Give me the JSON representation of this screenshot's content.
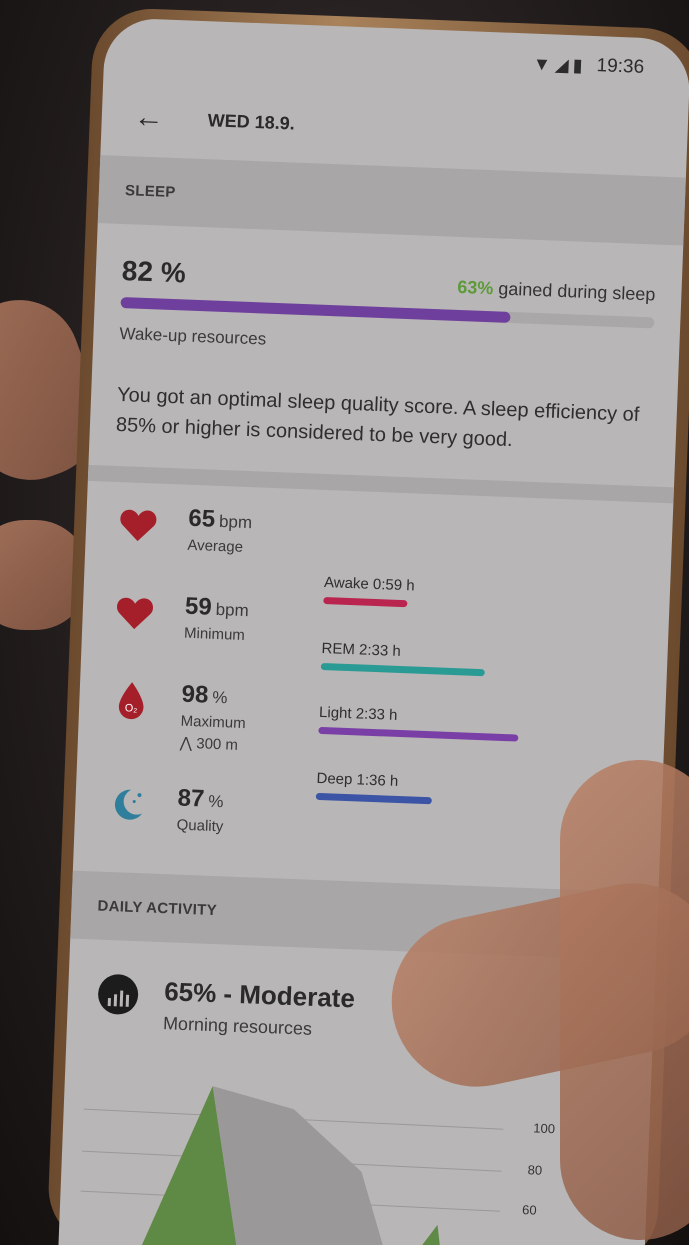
{
  "status": {
    "time": "19:36",
    "icons": "▼◢▮"
  },
  "appbar": {
    "back_icon": "←",
    "title": "WED 18.9."
  },
  "sleep": {
    "header": "SLEEP",
    "score": "82 %",
    "gain_pct": "63%",
    "gain_text": " gained during sleep",
    "progress": 0.73,
    "resources_label": "Wake-up resources",
    "description": "You got an optimal sleep quality score. A sleep efficiency of 85% or higher is considered to be very good."
  },
  "metrics": [
    {
      "value": "65",
      "unit": "bpm",
      "label": "Average",
      "icon": "heart-icon"
    },
    {
      "value": "59",
      "unit": "bpm",
      "label": "Minimum",
      "icon": "heart-icon"
    },
    {
      "value": "98",
      "unit": "%",
      "label": "Maximum",
      "extra": "⋀ 300 m",
      "icon": "oxygen-drop-icon"
    },
    {
      "value": "87",
      "unit": "%",
      "label": "Quality",
      "icon": "moon-icon"
    }
  ],
  "stages": [
    {
      "label": "Awake 0:59 h",
      "color": "#b9254f",
      "fraction": 0.42
    },
    {
      "label": "REM 2:33 h",
      "color": "#2a9a94",
      "fraction": 0.82
    },
    {
      "label": "Light 2:33 h",
      "color": "#7a3fa6",
      "fraction": 1.0
    },
    {
      "label": "Deep 1:36 h",
      "color": "#3b54a5",
      "fraction": 0.58
    }
  ],
  "activity": {
    "header": "DAILY ACTIVITY",
    "title": "65% - Moderate",
    "subtitle": "Morning resources",
    "ticks": [
      "100",
      "80",
      "60"
    ]
  },
  "colors": {
    "heart": "#a51f2a",
    "moon": "#2f7f9c"
  }
}
